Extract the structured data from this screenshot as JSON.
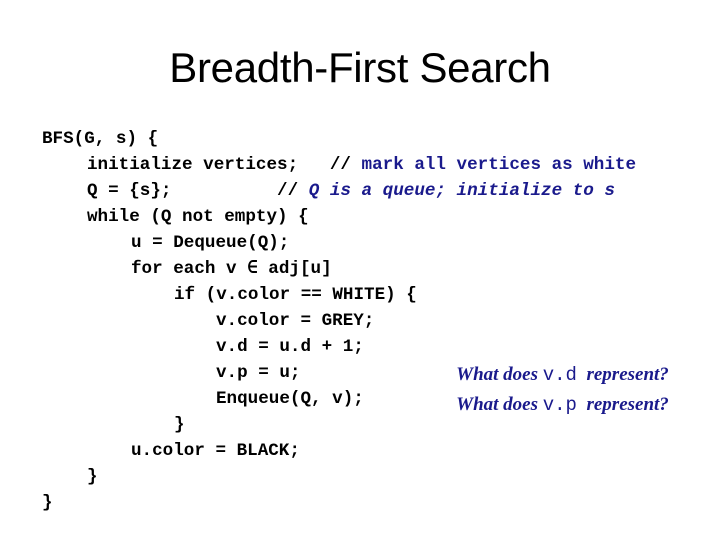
{
  "slide": {
    "title": "Breadth-First Search",
    "code_lines": [
      {
        "indent": 0,
        "code": "BFS(G, s) {",
        "comment": null
      },
      {
        "indent": 1,
        "code": "initialize vertices;   ",
        "comment": "mark all vertices as white",
        "comment_style": "normal"
      },
      {
        "indent": 1,
        "code": "Q = {s};          ",
        "comment": "Q is a queue; initialize to s",
        "comment_style": "italic"
      },
      {
        "indent": 1,
        "code": "while (Q not empty) {",
        "comment": null
      },
      {
        "indent": 2,
        "code": "u = Dequeue(Q);",
        "comment": null
      },
      {
        "indent": 2,
        "code": "for each v ∈ adj[u]",
        "comment": null
      },
      {
        "indent": 3,
        "code": "if (v.color == WHITE) {",
        "comment": null
      },
      {
        "indent": 4,
        "code": "v.color = GREY;",
        "comment": null
      },
      {
        "indent": 4,
        "code": "v.d = u.d + 1;",
        "comment": null
      },
      {
        "indent": 4,
        "code": "v.p = u;",
        "comment": null
      },
      {
        "indent": 4,
        "code": "Enqueue(Q, v);",
        "comment": null
      },
      {
        "indent": 3,
        "code": "}",
        "comment": null
      },
      {
        "indent": 2,
        "code": "u.color = BLACK;",
        "comment": null
      },
      {
        "indent": 1,
        "code": "}",
        "comment": null
      },
      {
        "indent": 0,
        "code": "}",
        "comment": null
      }
    ],
    "comment_prefix": "// ",
    "questions": [
      {
        "prefix": "What does ",
        "code": "v.d",
        "suffix": "  represent?"
      },
      {
        "prefix": "What does ",
        "code": "v.p",
        "suffix": "  represent?"
      }
    ],
    "colors": {
      "text": "#000000",
      "comment": "#1a1a8c",
      "question": "#1a1a8c",
      "background": "#ffffff"
    }
  }
}
